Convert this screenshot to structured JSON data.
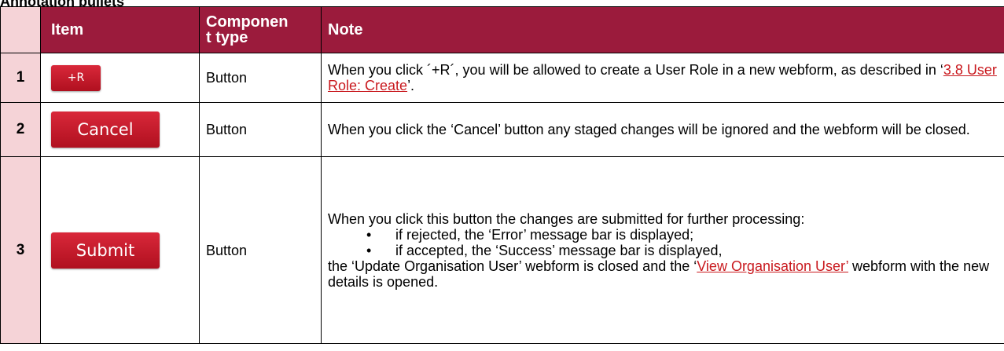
{
  "heading": "Annotation bullets",
  "table": {
    "headers": {
      "item": "Item",
      "component_type_line1": "Componen",
      "component_type_line2": "t type",
      "note": "Note"
    },
    "rows": [
      {
        "number": "1",
        "button_label": "+R",
        "component_type": "Button",
        "note_before_link": "When you click ´+R´, you will be allowed to create a User Role in a new webform, as described in ‘",
        "note_link": "3.8 User Role: Create",
        "note_after_link": "’."
      },
      {
        "number": "2",
        "button_label": "Cancel",
        "component_type": "Button",
        "note": "When you click the ‘Cancel’ button any staged changes will be ignored and the webform will be closed."
      },
      {
        "number": "3",
        "button_label": "Submit",
        "component_type": "Button",
        "note_intro": "When you click this button the changes are submitted for further processing:",
        "bullets": [
          "if rejected, the ‘Error’ message bar is displayed;",
          "if accepted, the ‘Success’ message bar is displayed,"
        ],
        "note_outro_before_link": "the ‘Update Organisation User’ webform is closed and the ‘",
        "note_outro_link": "View Organisation User’",
        "note_outro_after_link": " webform with the new details is opened."
      }
    ]
  },
  "colors": {
    "header_background": "#9b1b3c",
    "number_column_background": "#f5d3d7",
    "link": "#c9191e",
    "button_red": "#c41a2c"
  }
}
